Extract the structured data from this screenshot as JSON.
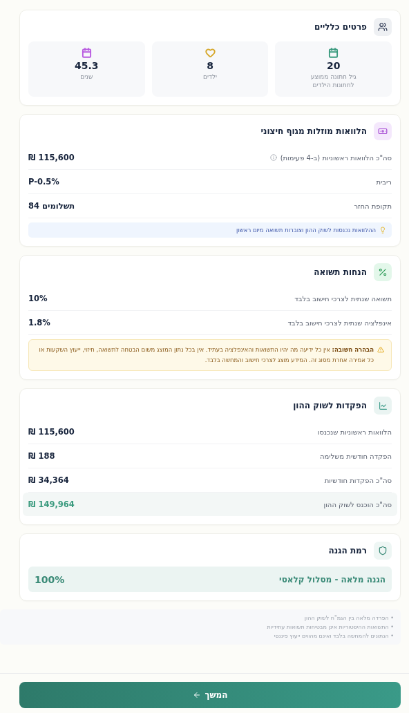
{
  "general": {
    "title": "פרטים כלליים",
    "stats": [
      {
        "kind": "calendar",
        "color": "#3a9a7e",
        "value": "20",
        "label": "גיל חתונה ממוצע לחתונות הילדים"
      },
      {
        "kind": "heart",
        "color": "#d6a72a",
        "value": "8",
        "label": "ילדים"
      },
      {
        "kind": "calendar",
        "color": "#b85ae0",
        "value": "45.3",
        "label": "שנים"
      }
    ]
  },
  "loans": {
    "title": "הלוואות מוזלות מגוף חיצוני",
    "rows": [
      {
        "label": "סה\"כ הלוואות ראשוניות (ב-4 פעימות)",
        "info": true,
        "value": "₪ 115,600"
      },
      {
        "label": "ריבית",
        "info": false,
        "value": "P-0.5%"
      },
      {
        "label": "תקופת החזר",
        "info": false,
        "value": "84 תשלומים"
      }
    ],
    "tip": "ההלוואות נכנסות לשוק ההון וצוברות תשואה מיום ראשון"
  },
  "assumptions": {
    "title": "הנחות תשואה",
    "rows": [
      {
        "label": "תשואה שנתית לצרכי חישוב בלבד",
        "value": "10%"
      },
      {
        "label": "אינפלציה שנתית לצרכי חישוב בלבד",
        "value": "1.8%"
      }
    ],
    "warning": "**הבהרה חשובה:** אין כל ידיעה מה יהיו התשואות והאינפלציה בעתיד. אין בכל נתון המוצג משום הבטחה לתשואה, חיזוי, ייעוץ השקעות או כל אמירה אחרת מסוג זה. המידע מוצג לצרכי חישוב והמחשה בלבד."
  },
  "deposits": {
    "title": "הפקדות לשוק ההון",
    "rows": [
      {
        "label": "הלוואות ראשוניות שנכנסו",
        "value": "₪ 115,600",
        "highlighted": false
      },
      {
        "label": "הפקדה חודשית משלימה",
        "value": "₪ 188",
        "highlighted": false
      },
      {
        "label": "סה\"כ הפקדות חודשיות",
        "value": "₪ 34,364",
        "highlighted": false
      },
      {
        "label": "סה\"כ הוכנס לשוק ההון",
        "value": "₪ 149,964",
        "highlighted": true
      }
    ]
  },
  "protection": {
    "title": "רמת הגנה",
    "label": "הגנה מלאה - מסלול קלאסי",
    "value": "100%"
  },
  "notes": [
    "• הפרדה מלאה בין הגמ\"ח לשוק ההון",
    "• התשואות ההיסטוריות אינן מבטיחות תשואות עתידיות",
    "• הנתונים להמחשה בלבד ואינם מהווים ייעוץ פיננסי"
  ],
  "continue_button": "המשך"
}
